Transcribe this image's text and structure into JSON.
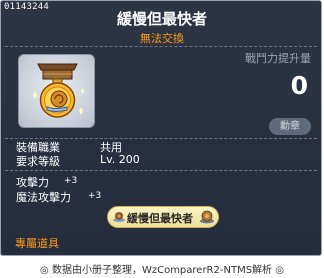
{
  "tooltip": {
    "item_id": "01143244",
    "item_name": "緩慢但最快者",
    "trade_status": "無法交換",
    "combat_power_label": "戰鬥力提升量",
    "combat_power_value": "0",
    "medal_label": "勳章",
    "job_label": "裝備職業",
    "job_value": "共用",
    "level_label": "要求等級",
    "level_value": "Lv. 200",
    "stats": [
      {
        "label": "攻擊力",
        "value": "+3"
      },
      {
        "label": "魔法攻擊力",
        "value": "+3"
      }
    ],
    "set_name": "緩慢但最快者",
    "exclusive_label": "專屬道具"
  },
  "footer": {
    "text": "◎ 数据由小册子整理，WzComparerR2-NTMS解析 ◎"
  },
  "colors": {
    "panel_bg": "#283040",
    "title_text": "#ffffff",
    "orange_text": "#ff9a1a",
    "grey_text": "#9aa4b4",
    "pill_bg": "#f5eab0"
  },
  "icons": [
    "medal-icon",
    "snail-icon",
    "snail-shell-icon"
  ]
}
